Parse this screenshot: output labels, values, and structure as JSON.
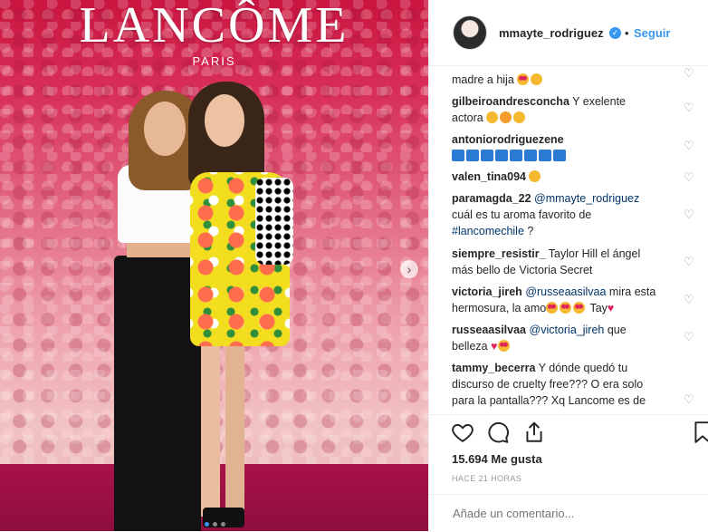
{
  "photo": {
    "brand": "LANCÔME",
    "brand_sub": "PARIS",
    "next_icon": "chevron-right-icon"
  },
  "header": {
    "username": "mmayte_rodriguez",
    "separator": "•",
    "follow_label": "Seguir",
    "verified_icon": "verified-badge-icon"
  },
  "comments": [
    {
      "user": "",
      "text": "madre a hija",
      "emojis": [
        "hearteyes",
        "kiss"
      ]
    },
    {
      "user": "gilbeiroandresconcha",
      "text": "Y exelente actora",
      "emojis": [
        "kiss",
        "flex",
        "kiss"
      ]
    },
    {
      "user": "antoniorodriguezene",
      "text": "",
      "emojis": [
        "top",
        "top",
        "top",
        "top",
        "top",
        "top",
        "top",
        "top"
      ]
    },
    {
      "user": "valen_tina094",
      "text": "",
      "emojis": [
        "wow"
      ]
    },
    {
      "user": "paramagda_22",
      "mention": "@mmayte_rodriguez",
      "text": "cuál es tu aroma favorito de",
      "hashtag": "#lancomechile",
      "tail": "?"
    },
    {
      "user": "siempre_resistir_",
      "text": "Taylor Hill el ángel más bello de Victoria Secret"
    },
    {
      "user": "victoria_jireh",
      "mention": "@russeaasilvaa",
      "text": "mira esta hermosura, la amo",
      "tail": "Tay",
      "emojis": [
        "hearteyes",
        "hearteyes",
        "hearteyes"
      ]
    },
    {
      "user": "russeaasilvaa",
      "mention": "@victoria_jireh",
      "text": "que belleza",
      "emojis": [
        "heart",
        "hearteyes"
      ]
    },
    {
      "user": "tammy_becerra",
      "text": "Y dónde quedó tu discurso de cruelty free??? O era solo para la pantalla??? Xq Lancome es de"
    }
  ],
  "actions": {
    "like_icon": "heart-icon",
    "comment_icon": "comment-icon",
    "share_icon": "share-icon",
    "save_icon": "bookmark-icon"
  },
  "likes": "15.694 Me gusta",
  "time": "HACE 21 HORAS",
  "add_comment_placeholder": "Añade un comentario...",
  "colors": {
    "accent": "#3897f0",
    "text": "#262626",
    "muted": "#999999"
  }
}
